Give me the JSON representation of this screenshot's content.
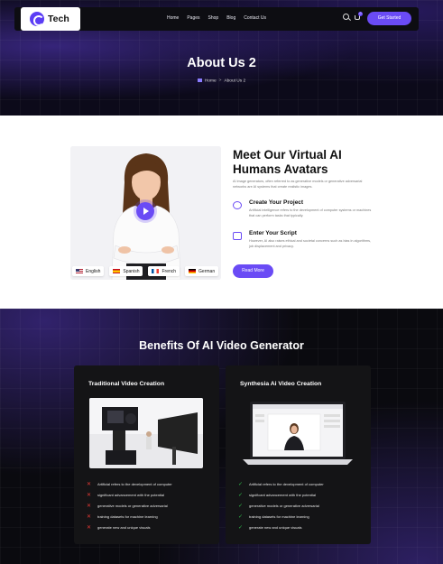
{
  "brand": {
    "name": "Tech"
  },
  "nav": {
    "links": [
      "Home",
      "Pages",
      "Shop",
      "Blog",
      "Contact Us"
    ],
    "cart_count": "0",
    "cta": "Get Started"
  },
  "hero": {
    "title": "About Us 2",
    "breadcrumb": {
      "home": "Home",
      "sep": ">",
      "current": "About Us 2"
    }
  },
  "about": {
    "title": "Meet Our Virtual AI Humans Avatars",
    "description": "AI image generators, often referred to as generative models or generative adversarial networks are AI systems that create realistic images.",
    "languages": [
      "English",
      "Spanish",
      "French",
      "German"
    ],
    "features": [
      {
        "icon": "refresh-icon",
        "title": "Create Your Project",
        "text": "Artificial intelligence refers to the development of computer systems or machines that can perform tasks that typically."
      },
      {
        "icon": "edit-icon",
        "title": "Enter Your Script",
        "text": "However, AI also raises ethical and societal concerns such as bias in algorithms, job displacement and privacy."
      }
    ],
    "button": "Read More"
  },
  "benefits": {
    "title": "Benefits Of AI Video Generator",
    "cards": [
      {
        "title": "Traditional Video Creation",
        "items": [
          "Artificial refers to the development of computer",
          "significant advancement with the potential",
          "generative models or generative adversarial",
          "training datasets for machine learning",
          "generate new and unique visuals"
        ]
      },
      {
        "title": "Synthesia Ai Video Creation",
        "items": [
          "Artificial refers to the development of computer",
          "significant advancement with the potential",
          "generative models or generative adversarial",
          "training datasets for machine learning",
          "generate new and unique visuals"
        ]
      }
    ]
  },
  "colors": {
    "accent": "#6a4bf5",
    "dark_bg": "#0a0a0f",
    "card_bg": "#141416",
    "cross": "#e53935",
    "check": "#2fbf4b"
  }
}
